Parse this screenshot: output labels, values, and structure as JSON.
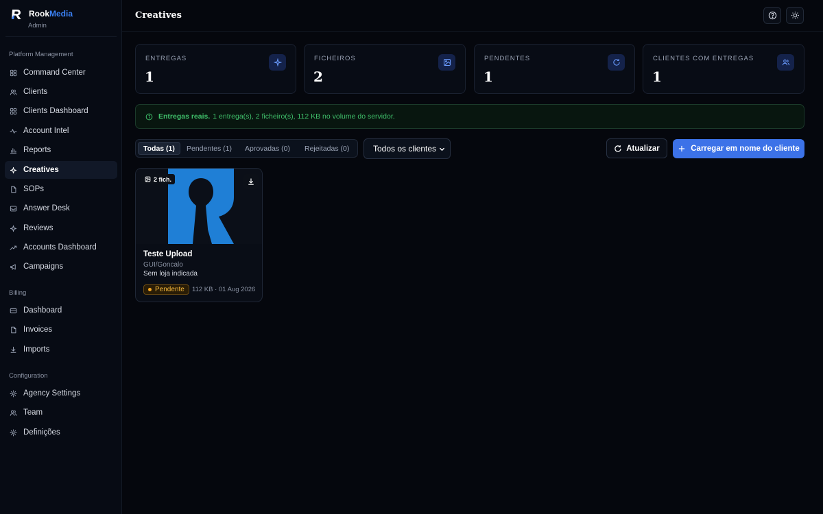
{
  "brand": {
    "name_part1": "Rook",
    "name_part2": "Media",
    "role": "Admin"
  },
  "sidebar": {
    "sections": [
      {
        "title": "Platform Management"
      },
      {
        "title": "Billing"
      },
      {
        "title": "Configuration"
      }
    ],
    "items": [
      {
        "label": "Command Center",
        "icon": "grid-icon"
      },
      {
        "label": "Clients",
        "icon": "users-icon"
      },
      {
        "label": "Clients Dashboard",
        "icon": "grid-icon"
      },
      {
        "label": "Account Intel",
        "icon": "activity-icon"
      },
      {
        "label": "Reports",
        "icon": "bar-chart-icon"
      },
      {
        "label": "Creatives",
        "icon": "sparkle-icon",
        "active": true
      },
      {
        "label": "SOPs",
        "icon": "file-icon"
      },
      {
        "label": "Answer Desk",
        "icon": "inbox-icon"
      },
      {
        "label": "Reviews",
        "icon": "sparkle-icon"
      },
      {
        "label": "Accounts Dashboard",
        "icon": "trending-icon"
      },
      {
        "label": "Campaigns",
        "icon": "megaphone-icon"
      },
      {
        "label": "Dashboard",
        "icon": "card-icon"
      },
      {
        "label": "Invoices",
        "icon": "file-icon"
      },
      {
        "label": "Imports",
        "icon": "download-icon"
      },
      {
        "label": "Agency Settings",
        "icon": "gear-icon"
      },
      {
        "label": "Team",
        "icon": "users-icon"
      },
      {
        "label": "Definições",
        "icon": "gear-icon"
      }
    ]
  },
  "header": {
    "title": "Creatives"
  },
  "stats": [
    {
      "label": "ENTREGAS",
      "value": "1",
      "icon": "sparkle-icon"
    },
    {
      "label": "FICHEIROS",
      "value": "2",
      "icon": "image-icon"
    },
    {
      "label": "PENDENTES",
      "value": "1",
      "icon": "refresh-icon"
    },
    {
      "label": "CLIENTES COM ENTREGAS",
      "value": "1",
      "icon": "users-icon"
    }
  ],
  "alert": {
    "strong": "Entregas reais.",
    "text": "1 entrega(s), 2 ficheiro(s), 112 KB no volume do servidor."
  },
  "tabs": [
    {
      "label": "Todas (1)",
      "active": true
    },
    {
      "label": "Pendentes (1)"
    },
    {
      "label": "Aprovadas (0)"
    },
    {
      "label": "Rejeitadas (0)"
    }
  ],
  "filters": {
    "client_select": "Todos os clientes"
  },
  "actions": {
    "refresh": "Atualizar",
    "upload": "Carregar em nome do cliente"
  },
  "colors": {
    "accent": "#3c72e8",
    "pending": "#f5a623",
    "success": "#3fbf6a",
    "logo": "#1f7fd6"
  },
  "creative": {
    "files_badge": "2 fich.",
    "title": "Teste Upload",
    "client": "GUI/Goncalo",
    "store": "Sem loja indicada",
    "status": "Pendente",
    "meta": "112 KB · 01 Aug 2026"
  }
}
